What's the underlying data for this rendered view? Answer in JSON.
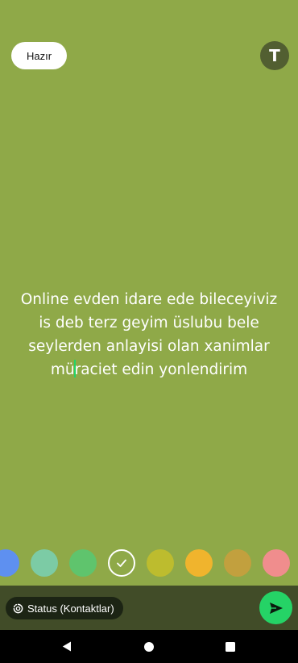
{
  "header": {
    "done_label": "Hazır",
    "font_button_label": "T"
  },
  "status": {
    "text_lines": [
      "Online  evden idare ede bileceyiviz",
      "is deb terz geyim üslubu bele",
      "seylerden anlayisi olan xanimlar"
    ],
    "last_line_before_cursor": "mü",
    "last_line_after_cursor": "raciet edin yonlendirim",
    "text_color": "#ffffff",
    "background_color": "#8fa948"
  },
  "palette": {
    "colors": [
      "#5e90f0",
      "#7ccba5",
      "#5fc46d",
      "#8fa948",
      "#bdbc2e",
      "#f0b42d",
      "#c2a03e",
      "#f08d8d"
    ],
    "selected_index": 3
  },
  "footer": {
    "audience_label": "Status (Kontaktlar)",
    "audience_icon": "status-ring-icon",
    "send_icon": "send-arrow-icon",
    "accent_color": "#25d366"
  },
  "navigation": {
    "back_icon": "back-triangle-icon",
    "home_icon": "home-circle-icon",
    "recents_icon": "recents-square-icon"
  }
}
